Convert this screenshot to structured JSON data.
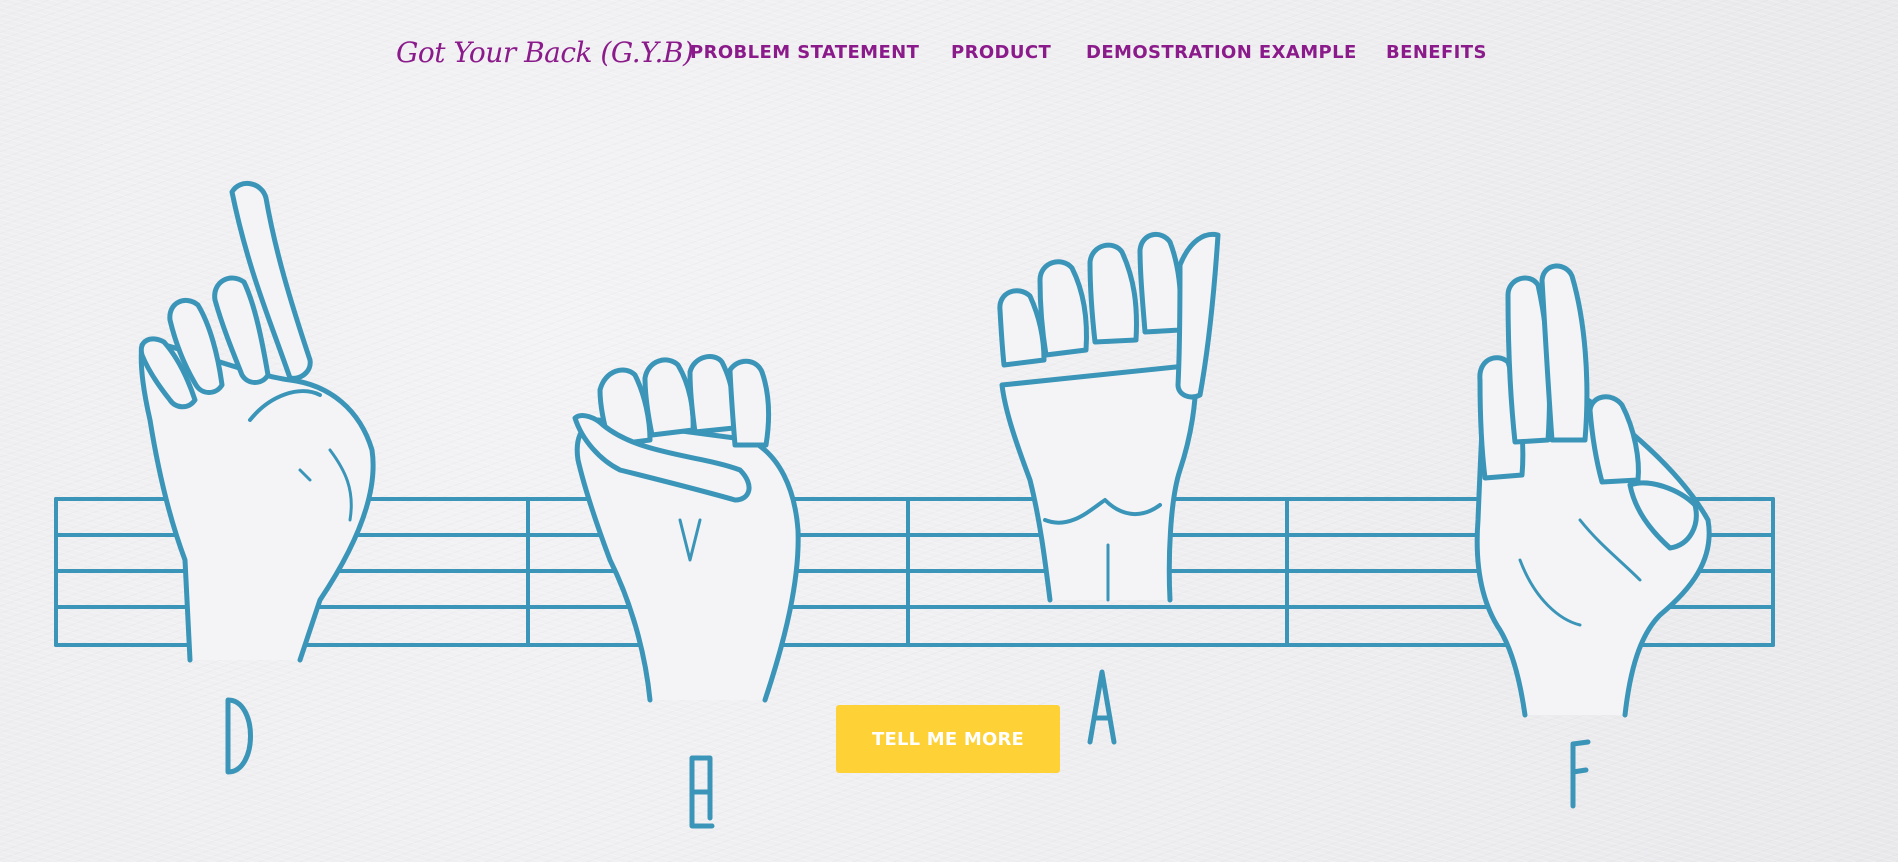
{
  "nav": {
    "brand": "Got Your Back (G.Y.B)",
    "links": [
      {
        "label": "PROBLEM STATEMENT"
      },
      {
        "label": "PRODUCT"
      },
      {
        "label": "DEMOSTRATION EXAMPLE"
      },
      {
        "label": "BENEFITS"
      }
    ]
  },
  "hero": {
    "letters": [
      "D",
      "E",
      "A",
      "F"
    ],
    "cta_label": "TELL ME MORE",
    "illustration_icons": [
      "staff-lines",
      "hand-sign-d-icon",
      "hand-sign-e-icon",
      "hand-sign-a-icon",
      "hand-sign-f-icon"
    ]
  },
  "colors": {
    "brand_purple": "#8b1a8b",
    "line_blue": "#3b95b8",
    "cta_yellow": "#fed136",
    "cta_text": "#ffffff",
    "background": "#eeeef0"
  }
}
